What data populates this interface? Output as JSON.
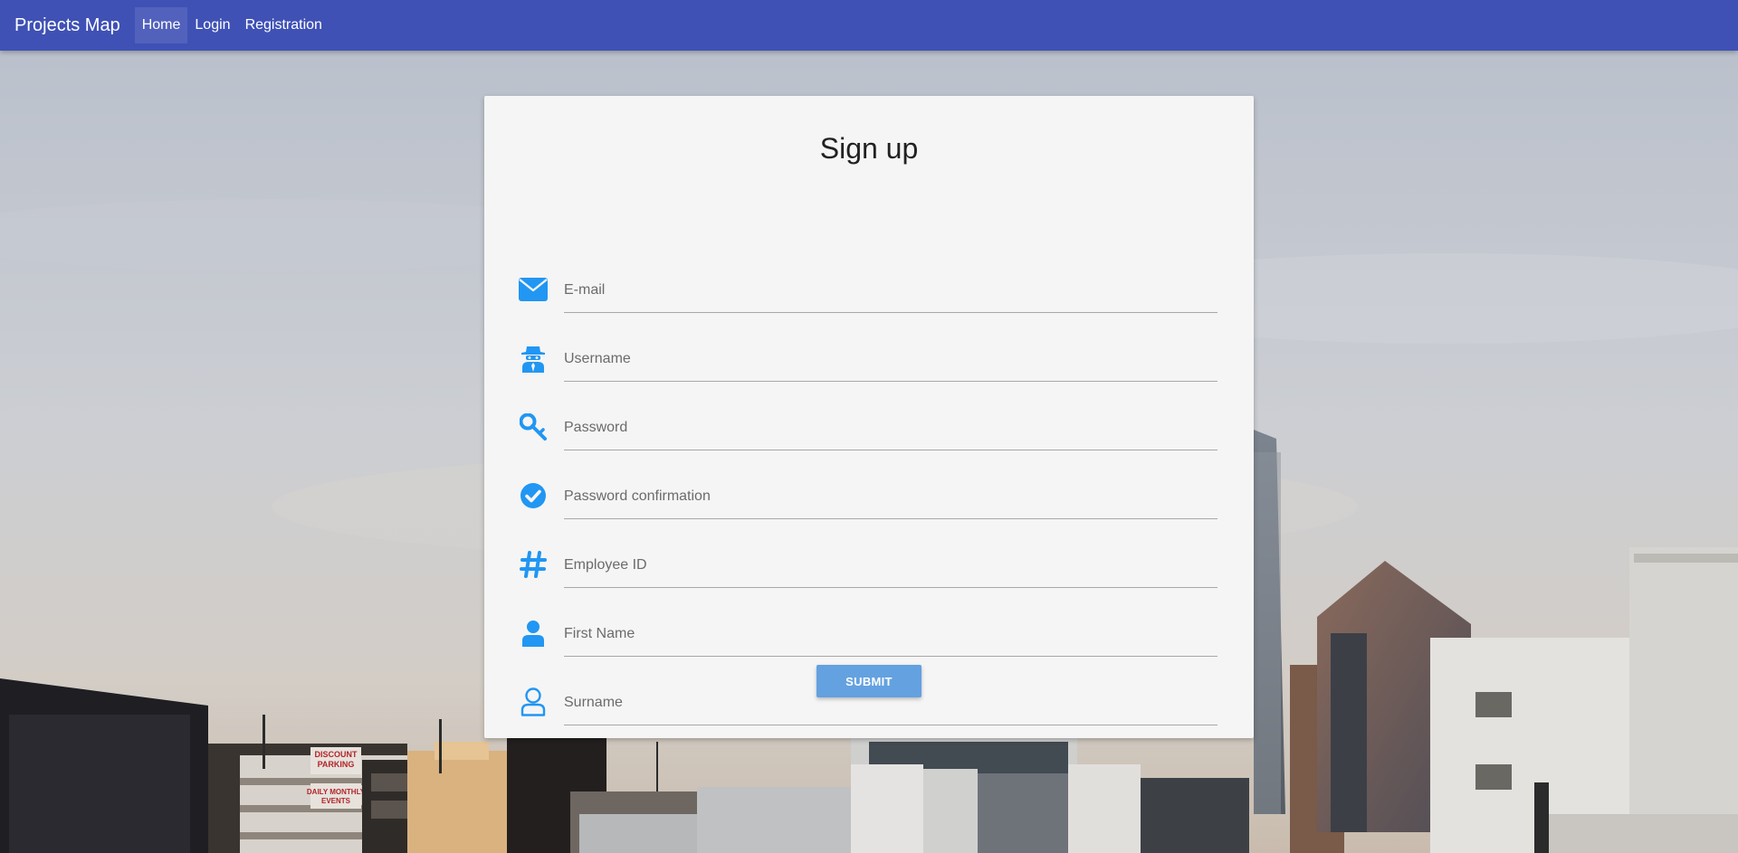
{
  "nav": {
    "brand": "Projects Map",
    "items": [
      {
        "label": "Home",
        "active": true
      },
      {
        "label": "Login",
        "active": false
      },
      {
        "label": "Registration",
        "active": false
      }
    ],
    "bg_color": "#3f51b5"
  },
  "form": {
    "title": "Sign up",
    "fields": [
      {
        "placeholder": "E-mail",
        "icon": "envelope-icon"
      },
      {
        "placeholder": "Username",
        "icon": "spy-icon"
      },
      {
        "placeholder": "Password",
        "icon": "key-icon"
      },
      {
        "placeholder": "Password confirmation",
        "icon": "check-circle-icon"
      },
      {
        "placeholder": "Employee ID",
        "icon": "hashtag-icon"
      },
      {
        "placeholder": "First Name",
        "icon": "user-solid-icon"
      },
      {
        "placeholder": "Surname",
        "icon": "user-outline-icon"
      }
    ],
    "submit_label": "SUBMIT",
    "icon_color": "#2196f3",
    "submit_color": "#64a1e0"
  },
  "background": {
    "sign_discount": "DISCOUNT PARKING",
    "sign_daily": "DAILY MONTHLY EVENTS"
  }
}
